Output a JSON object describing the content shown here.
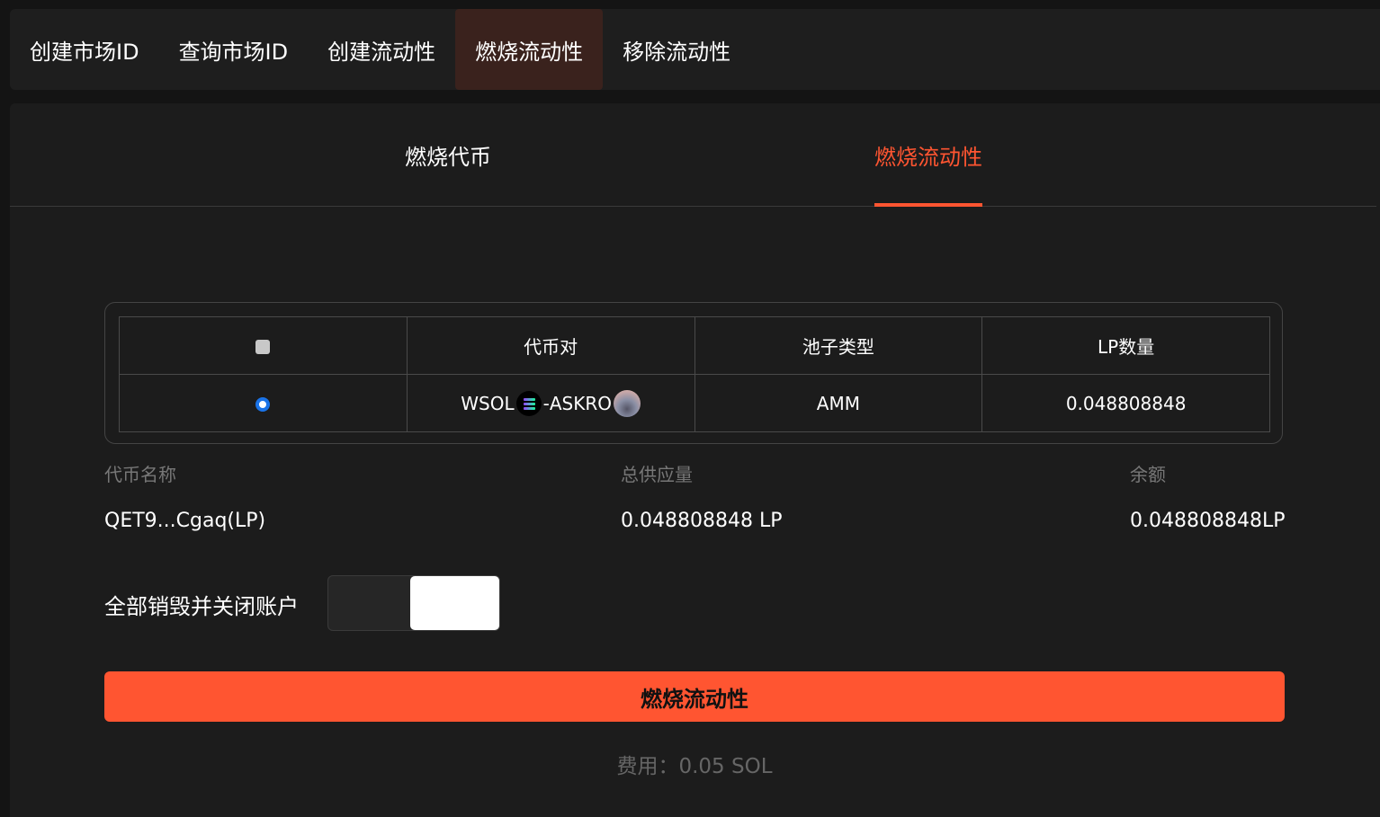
{
  "nav": {
    "tabs": [
      "创建市场ID",
      "查询市场ID",
      "创建流动性",
      "燃烧流动性",
      "移除流动性"
    ],
    "active_index": 3
  },
  "subtabs": {
    "burn_token": "燃烧代币",
    "burn_liquidity": "燃烧流动性",
    "active": "burn_liquidity"
  },
  "table": {
    "headers": [
      "",
      "代币对",
      "池子类型",
      "LP数量"
    ],
    "rows": [
      {
        "pair_base": "WSOL",
        "pair_sep": "- ",
        "pair_quote": "ASKRO",
        "pool_type": "AMM",
        "lp_amount": "0.048808848",
        "selected": true
      }
    ]
  },
  "info": {
    "name_label": "代币名称",
    "name_value": "QET9...Cgaq(LP)",
    "supply_label": "总供应量",
    "supply_value": "0.048808848 LP",
    "balance_label": "余额",
    "balance_value": "0.048808848LP"
  },
  "toggle": {
    "label": "全部销毁并关闭账户",
    "on": true
  },
  "action": {
    "burn_button": "燃烧流动性",
    "fee_text": "费用：0.05 SOL"
  },
  "colors": {
    "accent": "#ff5531",
    "background": "#141414",
    "panel": "#1c1c1c",
    "active_tab_bg": "#3a221d"
  },
  "icons": {
    "base_token": "solana-icon",
    "quote_token": "askro-token-icon"
  }
}
